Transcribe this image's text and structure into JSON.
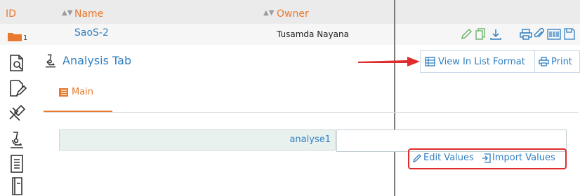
{
  "columns": {
    "id": "ID",
    "name": "Name",
    "owner": "Owner"
  },
  "record": {
    "id": "1",
    "name": "SaoS-2",
    "owner": "Tusamda Nayana"
  },
  "panel": {
    "title": "Analysis Tab"
  },
  "tabs": [
    {
      "label": "Main",
      "active": true
    }
  ],
  "buttons": {
    "view_list": "View In List Format",
    "print": "Print"
  },
  "field": {
    "label": "analyse1",
    "value": ""
  },
  "actions": {
    "edit": "Edit Values",
    "import": "Import Values"
  },
  "colors": {
    "accent": "#e8792f",
    "link": "#2f7fc1",
    "highlight": "#e02c2c"
  },
  "icons": [
    "sort-icon",
    "folder-icon",
    "pencil-icon",
    "copy-icon",
    "download-icon",
    "print-icon",
    "attach-icon",
    "barcode-icon",
    "save-icon",
    "document-search-icon",
    "document-edit-icon",
    "tools-icon",
    "microscope-icon",
    "notebook-icon",
    "book-icon",
    "table-icon",
    "list-icon",
    "arrow-icon",
    "import-icon"
  ]
}
